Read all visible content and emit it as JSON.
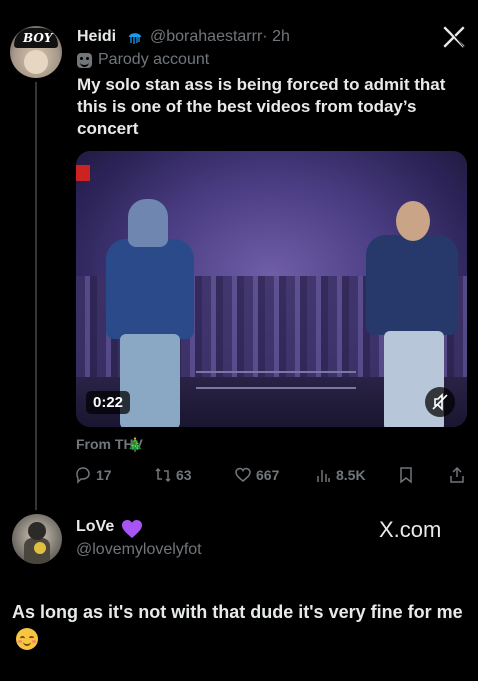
{
  "tweet": {
    "author_name": "Heidi",
    "author_handle": "@borahaestarrr",
    "time": "· 2h",
    "avatar_text": "BOY",
    "parody_label": "Parody account",
    "text": "My solo stan ass is being forced to admit that this is one of the best videos from today’s concert",
    "video_duration": "0:22",
    "source": "From THV",
    "source_emoji": "🎄",
    "stats": {
      "replies": "17",
      "retweets": "63",
      "likes": "667",
      "views": "8.5K"
    }
  },
  "reply": {
    "author_name": "LoVe",
    "author_handle": "@lovemylovelyfot",
    "watermark": "X.com",
    "text": "As long as it's not with that dude it's very fine for me",
    "emoji": "relieved-face"
  },
  "colors": {
    "background": "#000000",
    "primary_text": "#e7e9ea",
    "secondary_text": "#71767b",
    "verified_badge": "#1d9bf0",
    "heart_emoji": "#a855f7"
  }
}
